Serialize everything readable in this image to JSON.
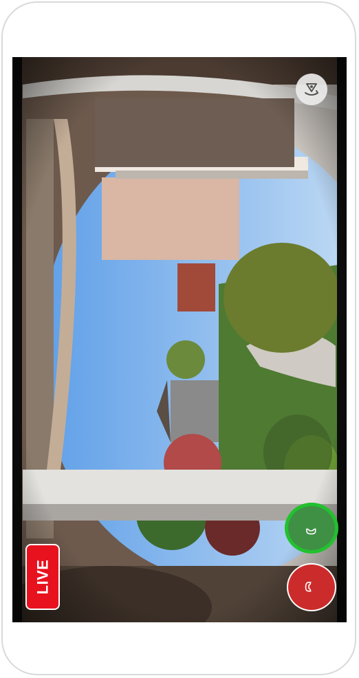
{
  "live_badge": {
    "label": "LIVE",
    "color": "#e8121f"
  },
  "icons": {
    "flip": "camera-rotate-icon",
    "answer": "phone-answer-icon",
    "decline": "phone-decline-icon"
  },
  "colors": {
    "answer": "#22c12e",
    "decline": "#cc2b2b"
  }
}
